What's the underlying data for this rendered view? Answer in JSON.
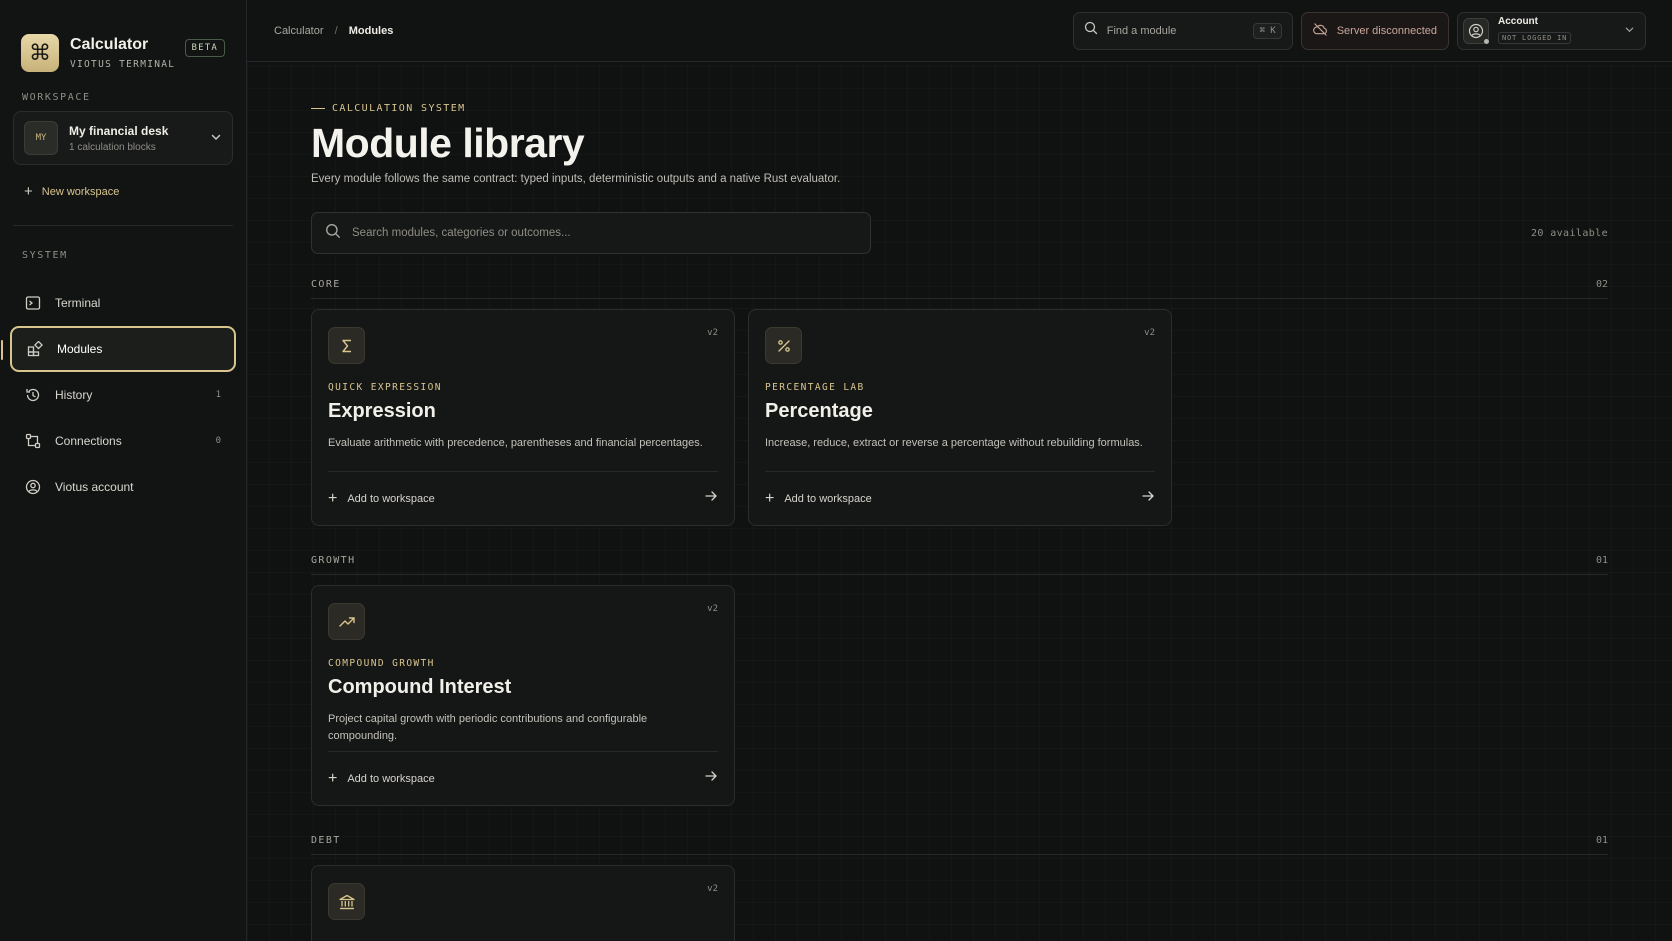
{
  "app": {
    "title": "Calculator",
    "subtitle": "VIOTUS TERMINAL",
    "badge": "BETA",
    "logo_icon": "command-icon"
  },
  "workspace": {
    "section_label": "WORKSPACE",
    "avatar": "MY",
    "name": "My financial desk",
    "count": "1 calculation blocks",
    "new_label": "New workspace"
  },
  "system": {
    "section_label": "SYSTEM",
    "items": [
      {
        "label": "Terminal",
        "icon": "terminal-icon",
        "count": ""
      },
      {
        "label": "Modules",
        "icon": "modules-icon",
        "count": "",
        "active": true
      },
      {
        "label": "History",
        "icon": "history-icon",
        "count": "1"
      },
      {
        "label": "Connections",
        "icon": "connections-icon",
        "count": "0"
      },
      {
        "label": "Viotus account",
        "icon": "user-circle-icon",
        "count": ""
      }
    ]
  },
  "topbar": {
    "breadcrumb_root": "Calculator",
    "breadcrumb_sep": "/",
    "breadcrumb_current": "Modules",
    "find_placeholder": "Find a module",
    "find_shortcut": "⌘ K",
    "server_status": "Server disconnected",
    "account_name": "Account",
    "account_status": "NOT LOGGED IN"
  },
  "page": {
    "kicker": "CALCULATION SYSTEM",
    "title": "Module library",
    "description": "Every module follows the same contract: typed inputs, deterministic outputs and a native Rust evaluator.",
    "search_placeholder": "Search modules, categories or outcomes...",
    "available": "20 available"
  },
  "categories": [
    {
      "name": "CORE",
      "count": "02",
      "cards": [
        {
          "icon": "sigma-icon",
          "version": "v2",
          "kicker": "QUICK EXPRESSION",
          "title": "Expression",
          "description": "Evaluate arithmetic with precedence, parentheses and financial percentages.",
          "action": "Add to workspace"
        },
        {
          "icon": "percent-icon",
          "version": "v2",
          "kicker": "PERCENTAGE LAB",
          "title": "Percentage",
          "description": "Increase, reduce, extract or reverse a percentage without rebuilding formulas.",
          "action": "Add to workspace"
        }
      ]
    },
    {
      "name": "GROWTH",
      "count": "01",
      "cards": [
        {
          "icon": "trending-up-icon",
          "version": "v2",
          "kicker": "COMPOUND GROWTH",
          "title": "Compound Interest",
          "description": "Project capital growth with periodic contributions and configurable compounding.",
          "action": "Add to workspace"
        }
      ]
    },
    {
      "name": "DEBT",
      "count": "01",
      "cards": [
        {
          "icon": "bank-icon",
          "version": "v2"
        }
      ]
    }
  ],
  "colors": {
    "accent": "#d8c58e",
    "background": "#101211",
    "sidebar": "#121413",
    "danger_text": "#c9a89a"
  }
}
